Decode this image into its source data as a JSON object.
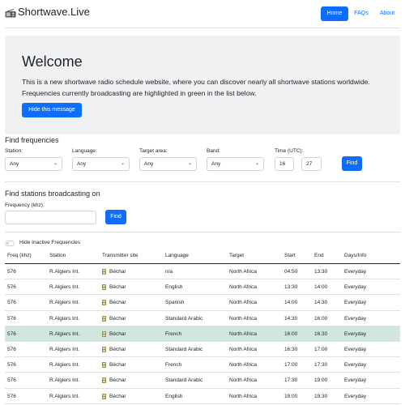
{
  "navbar": {
    "brand": "Shortwave.Live",
    "links": [
      {
        "label": "Home",
        "active": true
      },
      {
        "label": "FAQs",
        "active": false
      },
      {
        "label": "About",
        "active": false
      }
    ]
  },
  "hero": {
    "title": "Welcome",
    "text": "This is a new shortwave radio schedule website, where you can discover nearly all shortwave stations worldwide. Frequencies currently broadcasting are highlighted in green in the list below.",
    "button": "Hide this message"
  },
  "find_frequencies": {
    "title": "Find frequencies",
    "station": {
      "label": "Station:",
      "value": "Any"
    },
    "language": {
      "label": "Language:",
      "value": "Any"
    },
    "target": {
      "label": "Target area:",
      "value": "Any"
    },
    "band": {
      "label": "Band:",
      "value": "Any"
    },
    "time": {
      "label": "Time (UTC):",
      "hour": "16",
      "minute": "27"
    },
    "button": "Find"
  },
  "find_stations": {
    "title": "Find stations broadcasting on",
    "frequency_label": "Frequency (khz):",
    "frequency_value": "",
    "button": "Find"
  },
  "toggle": {
    "label": "Hide Inactive Frequencies",
    "checked": false
  },
  "table": {
    "headers": [
      "Freq (khz)",
      "Station",
      "Transmitter site",
      "Language",
      "Target",
      "Start",
      "End",
      "Days/Info"
    ],
    "rows": [
      {
        "freq": "576",
        "station": "R.Algiers Int.",
        "site": "Béchar",
        "language": "n/a",
        "target": "North Africa",
        "start": "04:50",
        "end": "13:30",
        "days": "Everyday",
        "active": false
      },
      {
        "freq": "576",
        "station": "R.Algiers Int.",
        "site": "Béchar",
        "language": "English",
        "target": "North Africa",
        "start": "13:30",
        "end": "14:00",
        "days": "Everyday",
        "active": false
      },
      {
        "freq": "576",
        "station": "R.Algiers Int.",
        "site": "Béchar",
        "language": "Spanish",
        "target": "North Africa",
        "start": "14:00",
        "end": "14:30",
        "days": "Everyday",
        "active": false
      },
      {
        "freq": "576",
        "station": "R.Algiers Int.",
        "site": "Béchar",
        "language": "Standard Arabic",
        "target": "North Africa",
        "start": "14:30",
        "end": "16:00",
        "days": "Everyday",
        "active": false
      },
      {
        "freq": "576",
        "station": "R.Algiers Int.",
        "site": "Béchar",
        "language": "French",
        "target": "North Africa",
        "start": "16:00",
        "end": "16:30",
        "days": "Everyday",
        "active": true
      },
      {
        "freq": "576",
        "station": "R.Algiers Int.",
        "site": "Béchar",
        "language": "Standard Arabic",
        "target": "North Africa",
        "start": "16:30",
        "end": "17:00",
        "days": "Everyday",
        "active": false
      },
      {
        "freq": "576",
        "station": "R.Algiers Int.",
        "site": "Béchar",
        "language": "French",
        "target": "North Africa",
        "start": "17:00",
        "end": "17:30",
        "days": "Everyday",
        "active": false
      },
      {
        "freq": "576",
        "station": "R.Algiers Int.",
        "site": "Béchar",
        "language": "Standard Arabic",
        "target": "North Africa",
        "start": "17:30",
        "end": "19:00",
        "days": "Everyday",
        "active": false
      },
      {
        "freq": "576",
        "station": "R.Algiers Int.",
        "site": "Béchar",
        "language": "English",
        "target": "North Africa",
        "start": "19:00",
        "end": "19:30",
        "days": "Everyday",
        "active": false
      }
    ]
  },
  "icons": {
    "brand": "radio-icon",
    "site": "transmitter-tower-icon",
    "select": "chevron-down-icon"
  },
  "colors": {
    "primary": "#0d6efd",
    "active_row": "#d1e7dd",
    "hero_bg": "#f0f1f3"
  }
}
